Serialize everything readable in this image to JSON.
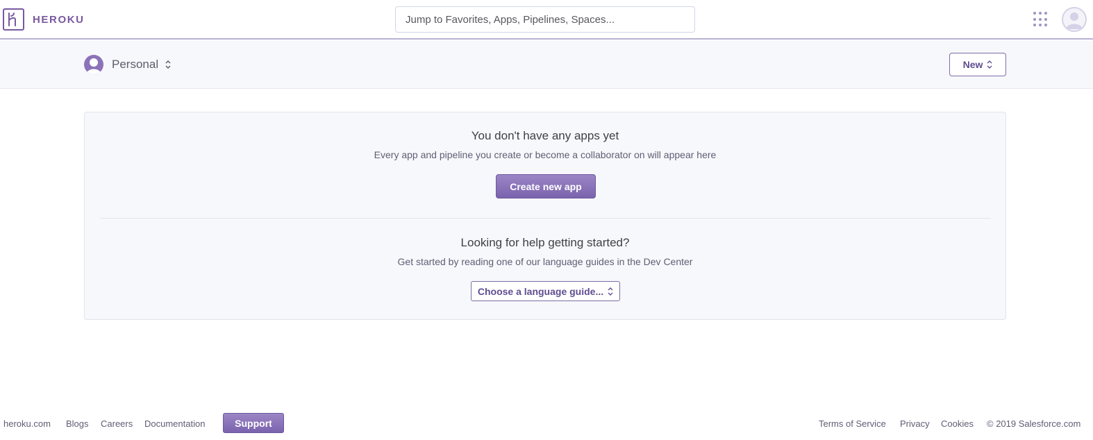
{
  "header": {
    "brand": "HEROKU",
    "search_placeholder": "Jump to Favorites, Apps, Pipelines, Spaces...",
    "icons": [
      "heroku-logo-icon",
      "apps-grid-icon",
      "user-avatar-icon"
    ]
  },
  "subheader": {
    "account_label": "Personal",
    "new_button_label": "New"
  },
  "empty_state": {
    "title": "You don't have any apps yet",
    "description": "Every app and pipeline you create or become a collaborator on will appear here",
    "create_button_label": "Create new app"
  },
  "help": {
    "title": "Looking for help getting started?",
    "description": "Get started by reading one of our language guides in the Dev Center",
    "language_select_label": "Choose a language guide..."
  },
  "footer": {
    "left_links": [
      "heroku.com",
      "Blogs",
      "Careers",
      "Documentation"
    ],
    "support_label": "Support",
    "right_links": [
      "Terms of Service",
      "Privacy",
      "Cookies"
    ],
    "copyright": "© 2019 Salesforce.com"
  },
  "colors": {
    "accent": "#79589f",
    "button_gradient_top": "#9c86c6",
    "button_gradient_bottom": "#7a63ad",
    "panel_background": "#f7f8fb"
  }
}
